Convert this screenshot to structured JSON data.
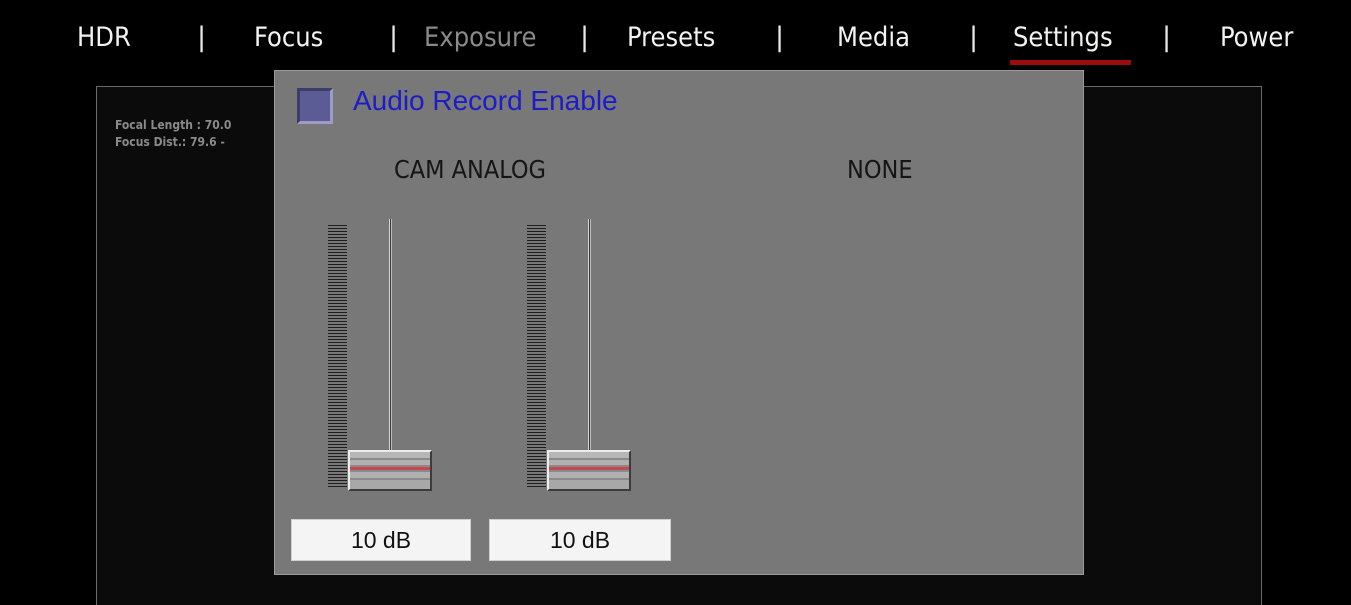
{
  "menu": {
    "items": [
      {
        "label": "HDR",
        "state": "normal"
      },
      {
        "label": "Focus",
        "state": "normal"
      },
      {
        "label": "Exposure",
        "state": "disabled"
      },
      {
        "label": "Presets",
        "state": "normal"
      },
      {
        "label": "Media",
        "state": "normal"
      },
      {
        "label": "Settings",
        "state": "selected"
      },
      {
        "label": "Power",
        "state": "normal"
      }
    ],
    "separator": "|",
    "selected_underline_color": "#9b0d0d"
  },
  "background": {
    "focal_length": "Focal Length : 70.0",
    "focus_dist": "Focus Dist.: 79.6 - "
  },
  "audio_dialog": {
    "enable_label": "Audio Record Enable",
    "enable_checked": false,
    "channels": [
      {
        "source_label": "CAM ANALOG",
        "gain_value": "10 dB",
        "level_fraction": 0.0
      },
      {
        "source_label": "NONE",
        "gain_value": "10 dB",
        "level_fraction": 0.0
      }
    ]
  },
  "colors": {
    "dialog_bg": "#787878",
    "label_blue": "#1c1cc8",
    "checkbox": "#5b5b96",
    "knob_red_line": "#c8484e"
  }
}
